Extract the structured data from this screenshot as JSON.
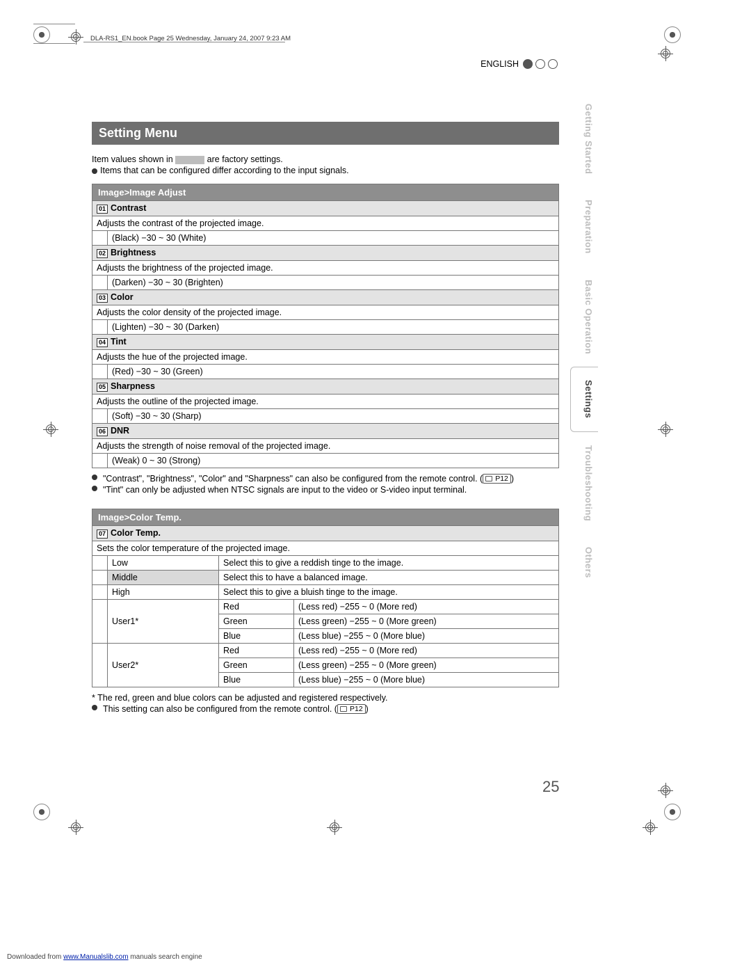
{
  "header_meta": "DLA-RS1_EN.book  Page 25  Wednesday, January 24, 2007  9:23 AM",
  "language_label": "ENGLISH",
  "page_number": "25",
  "section_title": "Setting Menu",
  "intro": {
    "line1_pre": "Item values shown in ",
    "line1_post": " are factory settings.",
    "line2": "Items that can be configured differ according to the input signals."
  },
  "image_adjust": {
    "subheader": "Image>Image Adjust",
    "rows": [
      {
        "num": "01",
        "name": "Contrast",
        "desc": "Adjusts the contrast of the projected image.",
        "range": "(Black) −30 ~ 30 (White)"
      },
      {
        "num": "02",
        "name": "Brightness",
        "desc": "Adjusts the brightness of the projected image.",
        "range": "(Darken) −30 ~ 30 (Brighten)"
      },
      {
        "num": "03",
        "name": "Color",
        "desc": "Adjusts the color density of the projected image.",
        "range": "(Lighten) −30 ~ 30 (Darken)"
      },
      {
        "num": "04",
        "name": "Tint",
        "desc": "Adjusts the hue of the projected image.",
        "range": "(Red) −30 ~ 30 (Green)"
      },
      {
        "num": "05",
        "name": "Sharpness",
        "desc": "Adjusts the outline of the projected image.",
        "range": "(Soft) −30 ~ 30 (Sharp)"
      },
      {
        "num": "06",
        "name": "DNR",
        "desc": "Adjusts the strength of noise removal of the projected image.",
        "range": "(Weak) 0 ~ 30 (Strong)"
      }
    ],
    "notes": [
      {
        "text": "\"Contrast\", \"Brightness\", \"Color\" and \"Sharpness\" can also be configured from the remote control. (",
        "ref": "P12",
        "tail": ")"
      },
      {
        "text": "\"Tint\" can only be adjusted when NTSC signals are input to the video or S-video input terminal.",
        "ref": null,
        "tail": ""
      }
    ]
  },
  "color_temp": {
    "subheader": "Image>Color Temp.",
    "head_num": "07",
    "head_name": "Color Temp.",
    "head_desc": "Sets the color temperature of the projected image.",
    "simple_rows": [
      {
        "label": "Low",
        "desc": "Select this to give a reddish tinge to the image.",
        "default": false
      },
      {
        "label": "Middle",
        "desc": "Select this to have a balanced image.",
        "default": true
      },
      {
        "label": "High",
        "desc": "Select this to give a bluish tinge to the image.",
        "default": false
      }
    ],
    "user_rows": [
      {
        "label": "User1*",
        "channels": [
          {
            "ch": "Red",
            "range": "(Less red) −255 ~ 0 (More red)"
          },
          {
            "ch": "Green",
            "range": "(Less green) −255 ~ 0 (More green)"
          },
          {
            "ch": "Blue",
            "range": "(Less blue) −255 ~ 0 (More blue)"
          }
        ]
      },
      {
        "label": "User2*",
        "channels": [
          {
            "ch": "Red",
            "range": "(Less red) −255 ~ 0 (More red)"
          },
          {
            "ch": "Green",
            "range": "(Less green) −255 ~ 0 (More green)"
          },
          {
            "ch": "Blue",
            "range": "(Less blue) −255 ~ 0 (More blue)"
          }
        ]
      }
    ],
    "footnote_ast": "* The red, green and blue colors can be adjusted and registered respectively.",
    "footnote_bul": "This setting can also be configured from the remote control. (",
    "footnote_ref": "P12",
    "footnote_tail": ")"
  },
  "tabs": [
    "Getting Started",
    "Preparation",
    "Basic Operation",
    "Settings",
    "Troubleshooting",
    "Others"
  ],
  "active_tab_index": 3,
  "footer": {
    "pre": "Downloaded from ",
    "link": "www.Manualslib.com",
    "post": " manuals search engine"
  }
}
